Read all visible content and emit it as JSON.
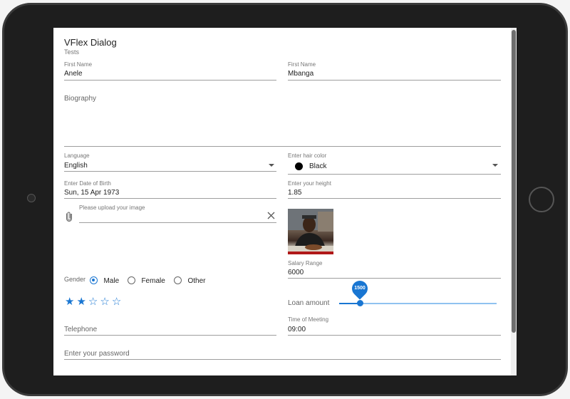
{
  "dialog": {
    "title": "VFlex Dialog",
    "subtitle": "Tests"
  },
  "first_name_left": {
    "label": "First Name",
    "value": "Anele"
  },
  "first_name_right": {
    "label": "First Name",
    "value": "Mbanga"
  },
  "biography": {
    "placeholder": "Biography"
  },
  "language": {
    "label": "Language",
    "value": "English"
  },
  "hair_color": {
    "label": "Enter hair color",
    "value": "Black",
    "swatch": "#000000"
  },
  "dob": {
    "label": "Enter Date of Birth",
    "value": "Sun, 15 Apr 1973"
  },
  "height": {
    "label": "Enter your height",
    "value": "1.85"
  },
  "upload": {
    "label": "Please upload your image",
    "attach_icon": "paperclip-icon",
    "clear_icon": "close-icon"
  },
  "photo": {
    "alt": "uploaded-photo"
  },
  "salary": {
    "label": "Salary Range",
    "value": "6000"
  },
  "gender": {
    "label": "Gender",
    "options": [
      "Male",
      "Female",
      "Other"
    ],
    "selected": "Male"
  },
  "rating": {
    "value": 2,
    "max": 5
  },
  "loan": {
    "label": "Loan amount",
    "value": "1500",
    "fraction": 0.13
  },
  "telephone": {
    "placeholder": "Telephone"
  },
  "meeting": {
    "label": "Time of Meeting",
    "value": "09:00"
  },
  "password": {
    "placeholder": "Enter your password"
  },
  "colors": {
    "accent": "#1976d2",
    "text": "#222222",
    "muted": "#777777"
  }
}
